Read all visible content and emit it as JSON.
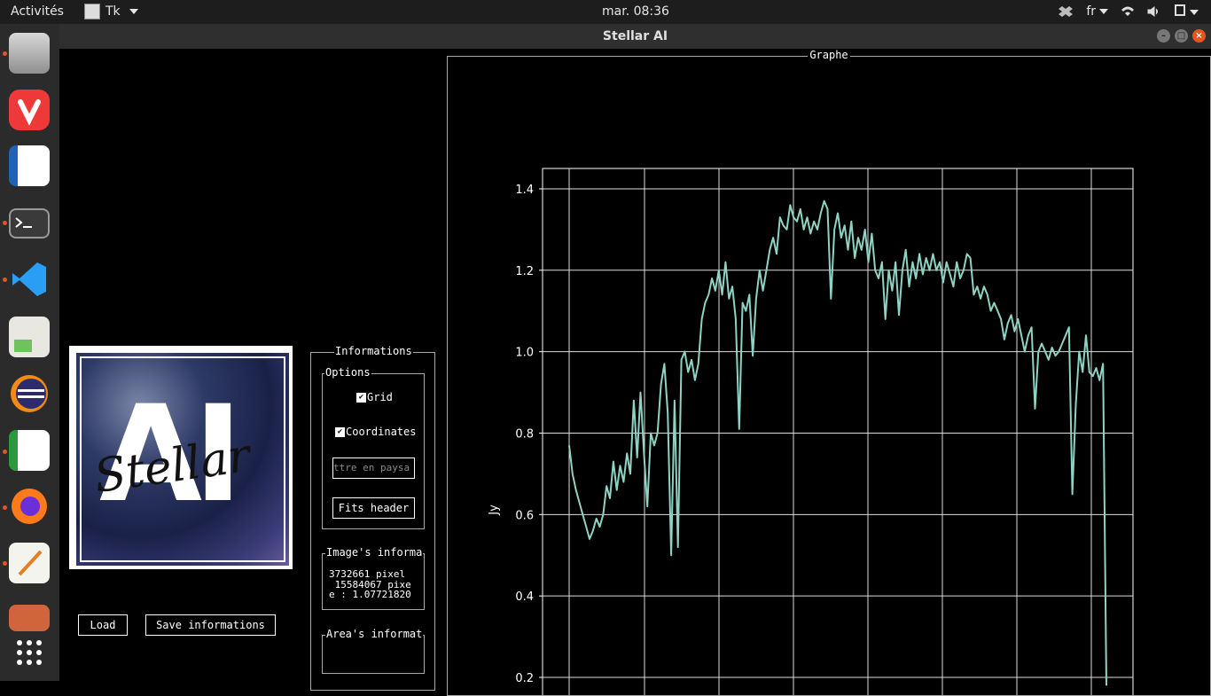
{
  "topbar": {
    "activities": "Activités",
    "app_name": "Tk",
    "clock": "mar. 08:36",
    "lang": "fr"
  },
  "window": {
    "title": "Stellar AI"
  },
  "logo": {
    "big_text": "AI",
    "script_text": "Stellar"
  },
  "buttons": {
    "load": "Load",
    "save": "Save informations"
  },
  "informations": {
    "title": "Informations",
    "options": {
      "title": "Options",
      "grid_label": "Grid",
      "grid_checked": true,
      "coords_label": "Coordinates",
      "coords_checked": true,
      "entry_value": "ttre en paysa",
      "fits_button": "Fits header"
    },
    "image_info": {
      "title": "Image's informa",
      "lines": [
        "3732661 pixel",
        " 15584067 pixe",
        "e : 1.07721820"
      ]
    },
    "area_info": {
      "title": "Area's informat"
    }
  },
  "graph": {
    "frame_title": "Graphe"
  },
  "chart_data": {
    "type": "line",
    "ylabel": "Jy",
    "xlabel": "",
    "ylim": [
      0.2,
      1.45
    ],
    "yticks": [
      0.2,
      0.4,
      0.6,
      0.8,
      1.0,
      1.2,
      1.4
    ],
    "ytick_labels": [
      "0.2",
      "0.4",
      "0.6",
      "0.8",
      "1.0",
      "1.2",
      "1.4"
    ],
    "grid": true,
    "series": [
      {
        "color": "#8fd3c4",
        "values": [
          0.77,
          0.7,
          0.66,
          0.63,
          0.6,
          0.57,
          0.54,
          0.56,
          0.59,
          0.57,
          0.6,
          0.67,
          0.64,
          0.73,
          0.66,
          0.72,
          0.68,
          0.75,
          0.7,
          0.88,
          0.74,
          0.9,
          0.75,
          0.62,
          0.8,
          0.77,
          0.8,
          0.92,
          0.97,
          0.85,
          0.5,
          0.88,
          0.52,
          0.98,
          1.0,
          0.95,
          0.98,
          0.93,
          0.97,
          1.08,
          1.12,
          1.14,
          1.18,
          1.15,
          1.2,
          1.14,
          1.22,
          1.13,
          1.16,
          1.08,
          0.81,
          1.12,
          1.1,
          1.14,
          0.99,
          1.13,
          1.2,
          1.15,
          1.2,
          1.25,
          1.28,
          1.24,
          1.33,
          1.31,
          1.3,
          1.36,
          1.33,
          1.32,
          1.35,
          1.3,
          1.33,
          1.29,
          1.32,
          1.3,
          1.34,
          1.37,
          1.35,
          1.13,
          1.3,
          1.34,
          1.28,
          1.31,
          1.25,
          1.32,
          1.23,
          1.28,
          1.25,
          1.3,
          1.22,
          1.29,
          1.2,
          1.18,
          1.22,
          1.08,
          1.2,
          1.15,
          1.22,
          1.09,
          1.2,
          1.25,
          1.16,
          1.22,
          1.18,
          1.24,
          1.19,
          1.23,
          1.2,
          1.24,
          1.2,
          1.22,
          1.17,
          1.22,
          1.19,
          1.16,
          1.22,
          1.18,
          1.2,
          1.24,
          1.23,
          1.14,
          1.16,
          1.13,
          1.16,
          1.14,
          1.1,
          1.12,
          1.1,
          1.08,
          1.03,
          1.07,
          1.09,
          1.05,
          1.08,
          1.04,
          1.0,
          1.04,
          1.06,
          0.86,
          1.0,
          1.02,
          1.0,
          0.98,
          1.01,
          0.99,
          1.0,
          1.02,
          1.04,
          1.06,
          0.65,
          0.87,
          1.0,
          0.95,
          1.04,
          0.95,
          0.94,
          0.96,
          0.93,
          0.97,
          0.18
        ]
      }
    ]
  }
}
